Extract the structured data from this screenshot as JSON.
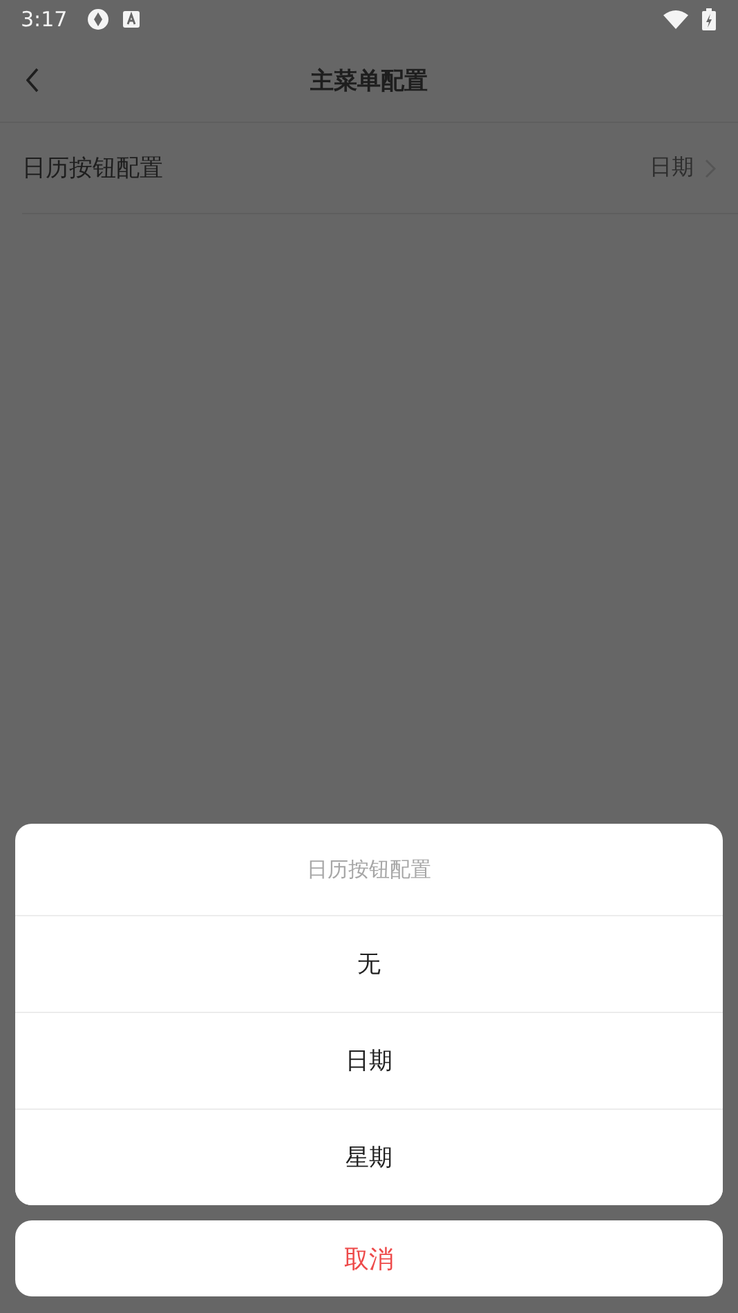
{
  "status_bar": {
    "time": "3:17"
  },
  "header": {
    "title": "主菜单配置"
  },
  "settings": [
    {
      "label": "日历按钮配置",
      "value": "日期"
    }
  ],
  "action_sheet": {
    "title": "日历按钮配置",
    "options": [
      {
        "label": "无"
      },
      {
        "label": "日期"
      },
      {
        "label": "星期"
      }
    ],
    "cancel": "取消"
  }
}
